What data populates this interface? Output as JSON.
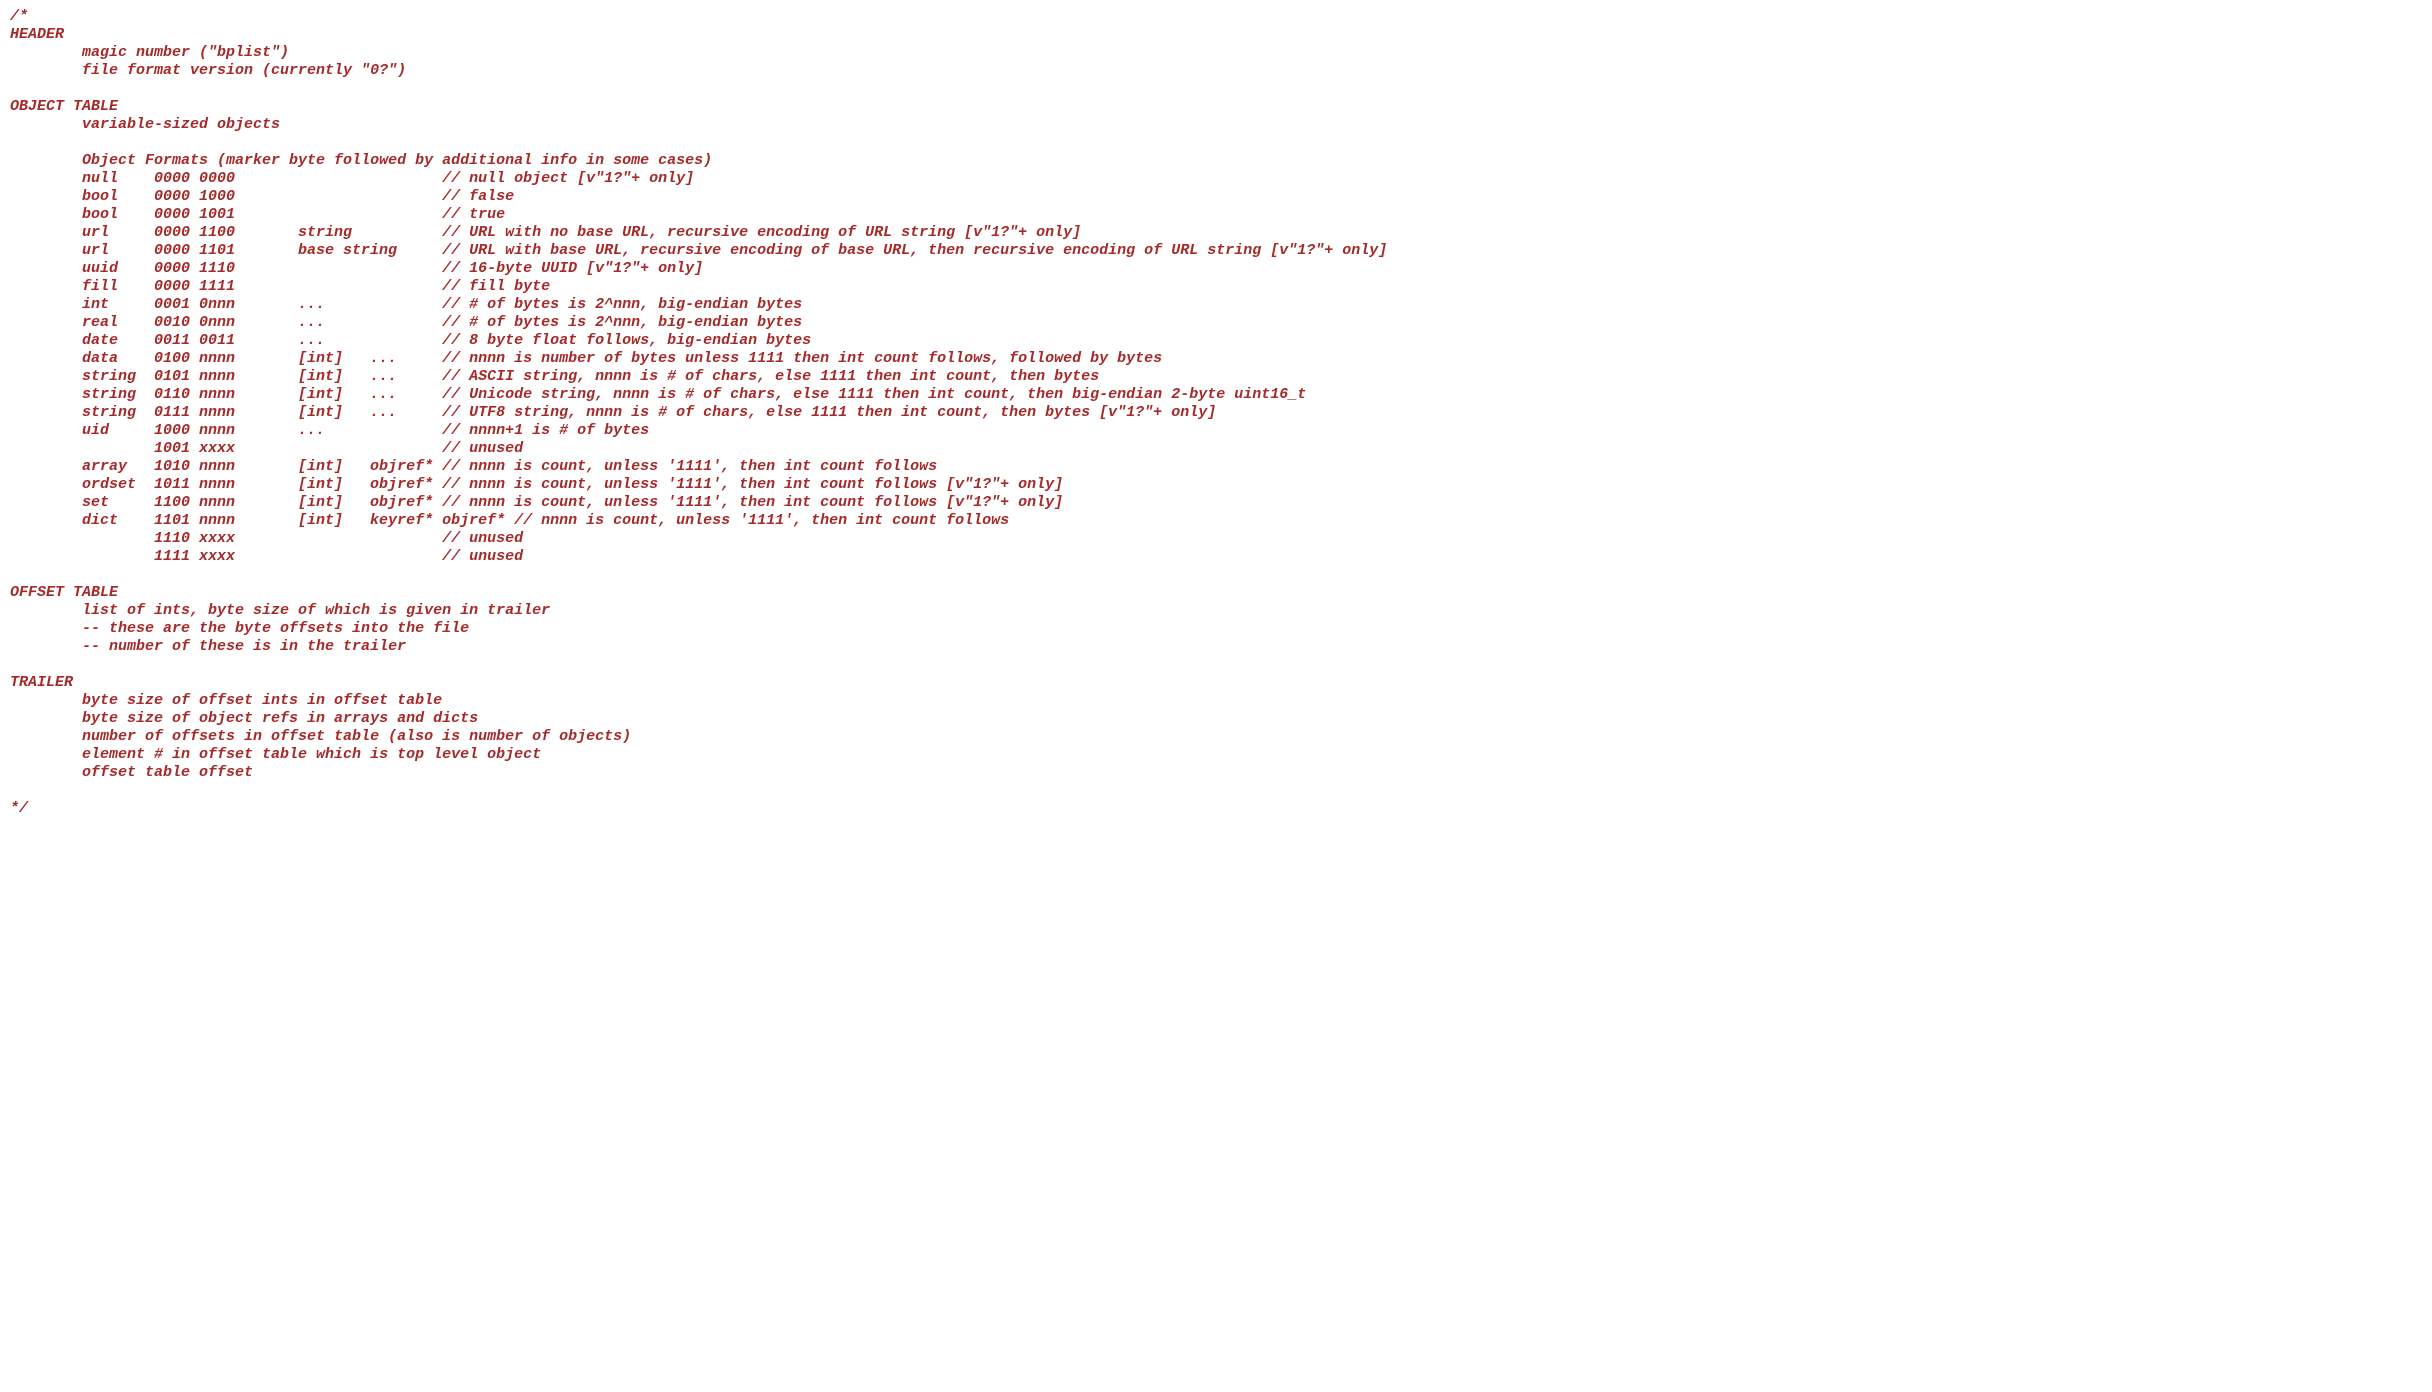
{
  "comment": {
    "open": "/*",
    "close": "*/",
    "header": {
      "title": "HEADER",
      "lines": [
        "magic number (\"bplist\")",
        "file format version (currently \"0?\")"
      ]
    },
    "object_table": {
      "title": "OBJECT TABLE",
      "intro": "variable-sized objects",
      "formats_header": "Object Formats (marker byte followed by additional info in some cases)",
      "rows": [
        {
          "name": "null",
          "bits": "0000 0000",
          "extra": "",
          "desc": "// null object [v\"1?\"+ only]"
        },
        {
          "name": "bool",
          "bits": "0000 1000",
          "extra": "",
          "desc": "// false"
        },
        {
          "name": "bool",
          "bits": "0000 1001",
          "extra": "",
          "desc": "// true"
        },
        {
          "name": "url",
          "bits": "0000 1100",
          "extra": "string",
          "desc": "// URL with no base URL, recursive encoding of URL string [v\"1?\"+ only]"
        },
        {
          "name": "url",
          "bits": "0000 1101",
          "extra": "base string",
          "desc": "// URL with base URL, recursive encoding of base URL, then recursive encoding of URL string [v\"1?\"+ only]"
        },
        {
          "name": "uuid",
          "bits": "0000 1110",
          "extra": "",
          "desc": "// 16-byte UUID [v\"1?\"+ only]"
        },
        {
          "name": "fill",
          "bits": "0000 1111",
          "extra": "",
          "desc": "// fill byte"
        },
        {
          "name": "int",
          "bits": "0001 0nnn",
          "extra": "...",
          "desc": "// # of bytes is 2^nnn, big-endian bytes"
        },
        {
          "name": "real",
          "bits": "0010 0nnn",
          "extra": "...",
          "desc": "// # of bytes is 2^nnn, big-endian bytes"
        },
        {
          "name": "date",
          "bits": "0011 0011",
          "extra": "...",
          "desc": "// 8 byte float follows, big-endian bytes"
        },
        {
          "name": "data",
          "bits": "0100 nnnn",
          "extra": "[int]   ...",
          "desc": "// nnnn is number of bytes unless 1111 then int count follows, followed by bytes"
        },
        {
          "name": "string",
          "bits": "0101 nnnn",
          "extra": "[int]   ...",
          "desc": "// ASCII string, nnnn is # of chars, else 1111 then int count, then bytes"
        },
        {
          "name": "string",
          "bits": "0110 nnnn",
          "extra": "[int]   ...",
          "desc": "// Unicode string, nnnn is # of chars, else 1111 then int count, then big-endian 2-byte uint16_t"
        },
        {
          "name": "string",
          "bits": "0111 nnnn",
          "extra": "[int]   ...",
          "desc": "// UTF8 string, nnnn is # of chars, else 1111 then int count, then bytes [v\"1?\"+ only]"
        },
        {
          "name": "uid",
          "bits": "1000 nnnn",
          "extra": "...",
          "desc": "// nnnn+1 is # of bytes"
        },
        {
          "name": "",
          "bits": "1001 xxxx",
          "extra": "",
          "desc": "// unused"
        },
        {
          "name": "array",
          "bits": "1010 nnnn",
          "extra": "[int]   objref*",
          "desc": "// nnnn is count, unless '1111', then int count follows"
        },
        {
          "name": "ordset",
          "bits": "1011 nnnn",
          "extra": "[int]   objref*",
          "desc": "// nnnn is count, unless '1111', then int count follows [v\"1?\"+ only]"
        },
        {
          "name": "set",
          "bits": "1100 nnnn",
          "extra": "[int]   objref*",
          "desc": "// nnnn is count, unless '1111', then int count follows [v\"1?\"+ only]"
        },
        {
          "name": "dict",
          "bits": "1101 nnnn",
          "extra": "[int]   keyref* objref*",
          "desc": "// nnnn is count, unless '1111', then int count follows"
        },
        {
          "name": "",
          "bits": "1110 xxxx",
          "extra": "",
          "desc": "// unused"
        },
        {
          "name": "",
          "bits": "1111 xxxx",
          "extra": "",
          "desc": "// unused"
        }
      ]
    },
    "offset_table": {
      "title": "OFFSET TABLE",
      "lines": [
        "list of ints, byte size of which is given in trailer",
        "-- these are the byte offsets into the file",
        "-- number of these is in the trailer"
      ]
    },
    "trailer": {
      "title": "TRAILER",
      "lines": [
        "byte size of offset ints in offset table",
        "byte size of object refs in arrays and dicts",
        "number of offsets in offset table (also is number of objects)",
        "element # in offset table which is top level object",
        "offset table offset"
      ]
    }
  }
}
